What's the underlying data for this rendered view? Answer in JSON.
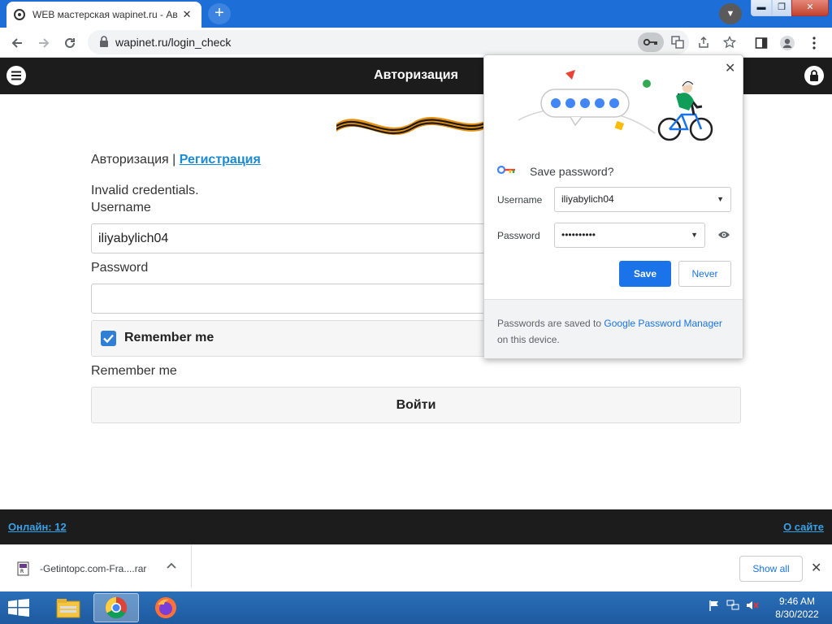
{
  "browser": {
    "tab_title": "WEB мастерская wapinet.ru - Ав",
    "tab_close": "✕",
    "new_tab": "+",
    "url": "wapinet.ru/login_check",
    "window_min": "▬",
    "window_max": "❐",
    "window_close": "✕"
  },
  "site": {
    "header_title": "Авторизация",
    "auth_label": "Авторизация | ",
    "register_link": "Регистрация",
    "error": "Invalid credentials.",
    "username_label": "Username",
    "username_value": "iliyabylich04",
    "password_label": "Password",
    "remember_checkbox_label": "Remember me",
    "remember_label": "Remember me",
    "login_button": "Войти",
    "footer_online": "Онлайн: 12",
    "footer_about": "О сайте"
  },
  "password_bubble": {
    "title": "Save password?",
    "username_label": "Username",
    "username_value": "iliyabylich04",
    "password_label": "Password",
    "password_value": "••••••••••",
    "save_button": "Save",
    "never_button": "Never",
    "footer_text_1": "Passwords are saved to ",
    "footer_link": "Google Password Manager",
    "footer_text_2": " on this device.",
    "close": "✕"
  },
  "downloads": {
    "filename": "-Getintopc.com-Fra....rar",
    "show_all": "Show all",
    "close": "✕"
  },
  "taskbar": {
    "time": "9:46 AM",
    "date": "8/30/2022"
  },
  "colors": {
    "accent_blue": "#1a73e8",
    "titlebar": "#1e6ed8",
    "site_dark": "#1c1c1c",
    "link": "#1a8ad5"
  }
}
